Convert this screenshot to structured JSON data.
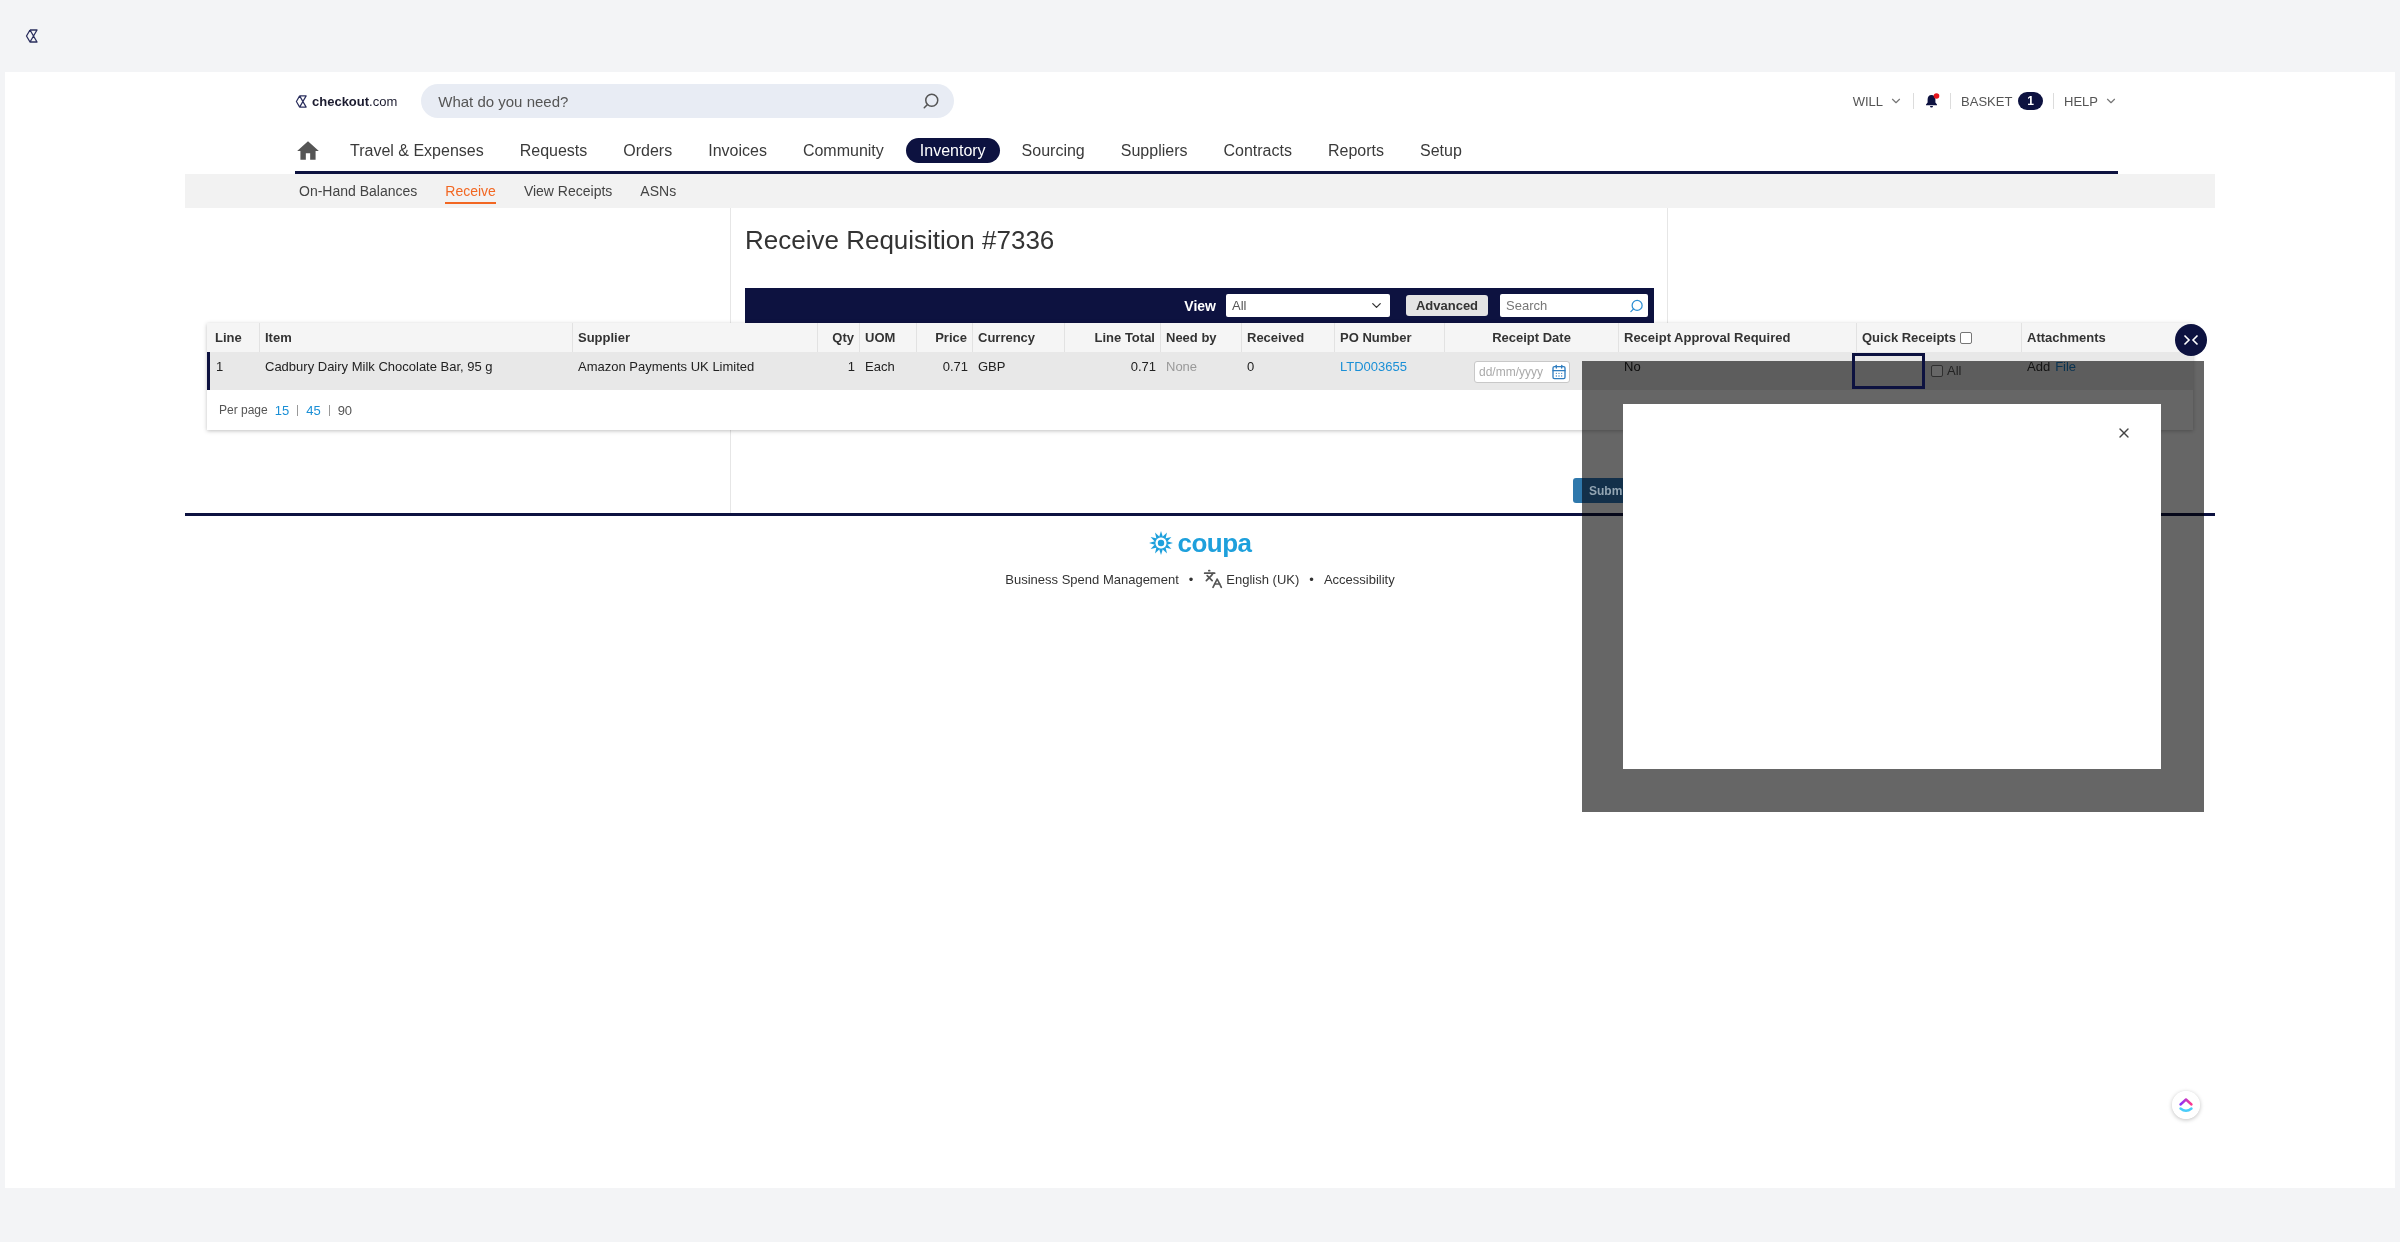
{
  "header": {
    "logo": "**checkout**.com",
    "search": {
      "placeholder": "What do you need?"
    },
    "user_menu": "WILL",
    "notifications_unread": true,
    "basket": {
      "label": "BASKET",
      "count": "1"
    },
    "help_menu": "HELP"
  },
  "nav": [
    {
      "kind": "home",
      "selected": false
    },
    {
      "kind": "link",
      "label": "Travel & Expenses",
      "selected": false
    },
    {
      "kind": "link",
      "label": "Requests",
      "selected": false
    },
    {
      "kind": "link",
      "label": "Orders",
      "selected": false
    },
    {
      "kind": "link",
      "label": "Invoices",
      "selected": false
    },
    {
      "kind": "link",
      "label": "Community",
      "selected": false
    },
    {
      "kind": "link",
      "label": "Inventory",
      "selected": true
    },
    {
      "kind": "link",
      "label": "Sourcing",
      "selected": false
    },
    {
      "kind": "link",
      "label": "Suppliers",
      "selected": false
    },
    {
      "kind": "link",
      "label": "Contracts",
      "selected": false
    },
    {
      "kind": "link",
      "label": "Reports",
      "selected": false
    },
    {
      "kind": "link",
      "label": "Setup",
      "selected": false
    }
  ],
  "subnav": [
    {
      "label": "On-Hand Balances",
      "selected": false
    },
    {
      "label": "Receive",
      "selected": true
    },
    {
      "label": "View Receipts",
      "selected": false
    },
    {
      "label": "ASNs",
      "selected": false
    }
  ],
  "title": "Receive Requisition #7336",
  "toolbar": {
    "view_label": "View",
    "view_select": "All",
    "advanced_button": "Advanced",
    "search": {
      "placeholder": "Search"
    }
  },
  "table": {
    "columns": [
      {
        "kind": "text",
        "label": "Line"
      },
      {
        "kind": "text",
        "label": "Item"
      },
      {
        "kind": "text",
        "label": "Supplier"
      },
      {
        "kind": "text",
        "label": "Qty"
      },
      {
        "kind": "text",
        "label": "UOM"
      },
      {
        "kind": "text",
        "label": "Price"
      },
      {
        "kind": "text",
        "label": "Currency"
      },
      {
        "kind": "text",
        "label": "Line Total"
      },
      {
        "kind": "text",
        "label": "Need by"
      },
      {
        "kind": "text",
        "label": "Received"
      },
      {
        "kind": "text",
        "label": "PO Number"
      },
      {
        "kind": "text",
        "label": "Receipt Date"
      },
      {
        "kind": "text",
        "label": "Receipt Approval Required"
      },
      {
        "kind": "checkbox",
        "label": "Quick Receipts",
        "checked": false
      },
      {
        "kind": "text",
        "label": "Attachments"
      }
    ],
    "rows": [
      {
        "selected": true,
        "cells": [
          {
            "kind": "text",
            "text": "1"
          },
          {
            "kind": "text",
            "text": "Cadbury Dairy Milk Chocolate Bar, 95 g"
          },
          {
            "kind": "text",
            "text": "Amazon Payments UK Limited"
          },
          {
            "kind": "text",
            "text": "1"
          },
          {
            "kind": "text",
            "text": "Each"
          },
          {
            "kind": "text",
            "text": "0.71"
          },
          {
            "kind": "text",
            "text": "GBP"
          },
          {
            "kind": "text",
            "text": "0.71"
          },
          {
            "kind": "muted",
            "text": "None"
          },
          {
            "kind": "text",
            "text": "0"
          },
          {
            "kind": "link",
            "text": "LTD003655"
          },
          {
            "kind": "date",
            "placeholder": "dd/mm/yyyy"
          },
          {
            "kind": "text",
            "text": "No"
          },
          {
            "kind": "quick_receipt",
            "focused": true,
            "checked": false,
            "label": "All"
          },
          {
            "kind": "attachment",
            "label": "Add",
            "link": "File"
          }
        ]
      }
    ]
  },
  "per_page": {
    "label": "Per page",
    "options": [
      {
        "text": "15",
        "selected": false
      },
      {
        "text": "45",
        "selected": false
      },
      {
        "text": "90",
        "selected": true
      }
    ]
  },
  "submit_button": "Subm",
  "footer": {
    "logo": "coupa",
    "links": [
      {
        "kind": "text",
        "text": "Business Spend Management"
      },
      {
        "kind": "separator",
        "text": "•"
      },
      {
        "kind": "language",
        "text": "English (UK)"
      },
      {
        "kind": "separator",
        "text": "•"
      },
      {
        "kind": "link",
        "text": "Accessibility"
      }
    ]
  }
}
